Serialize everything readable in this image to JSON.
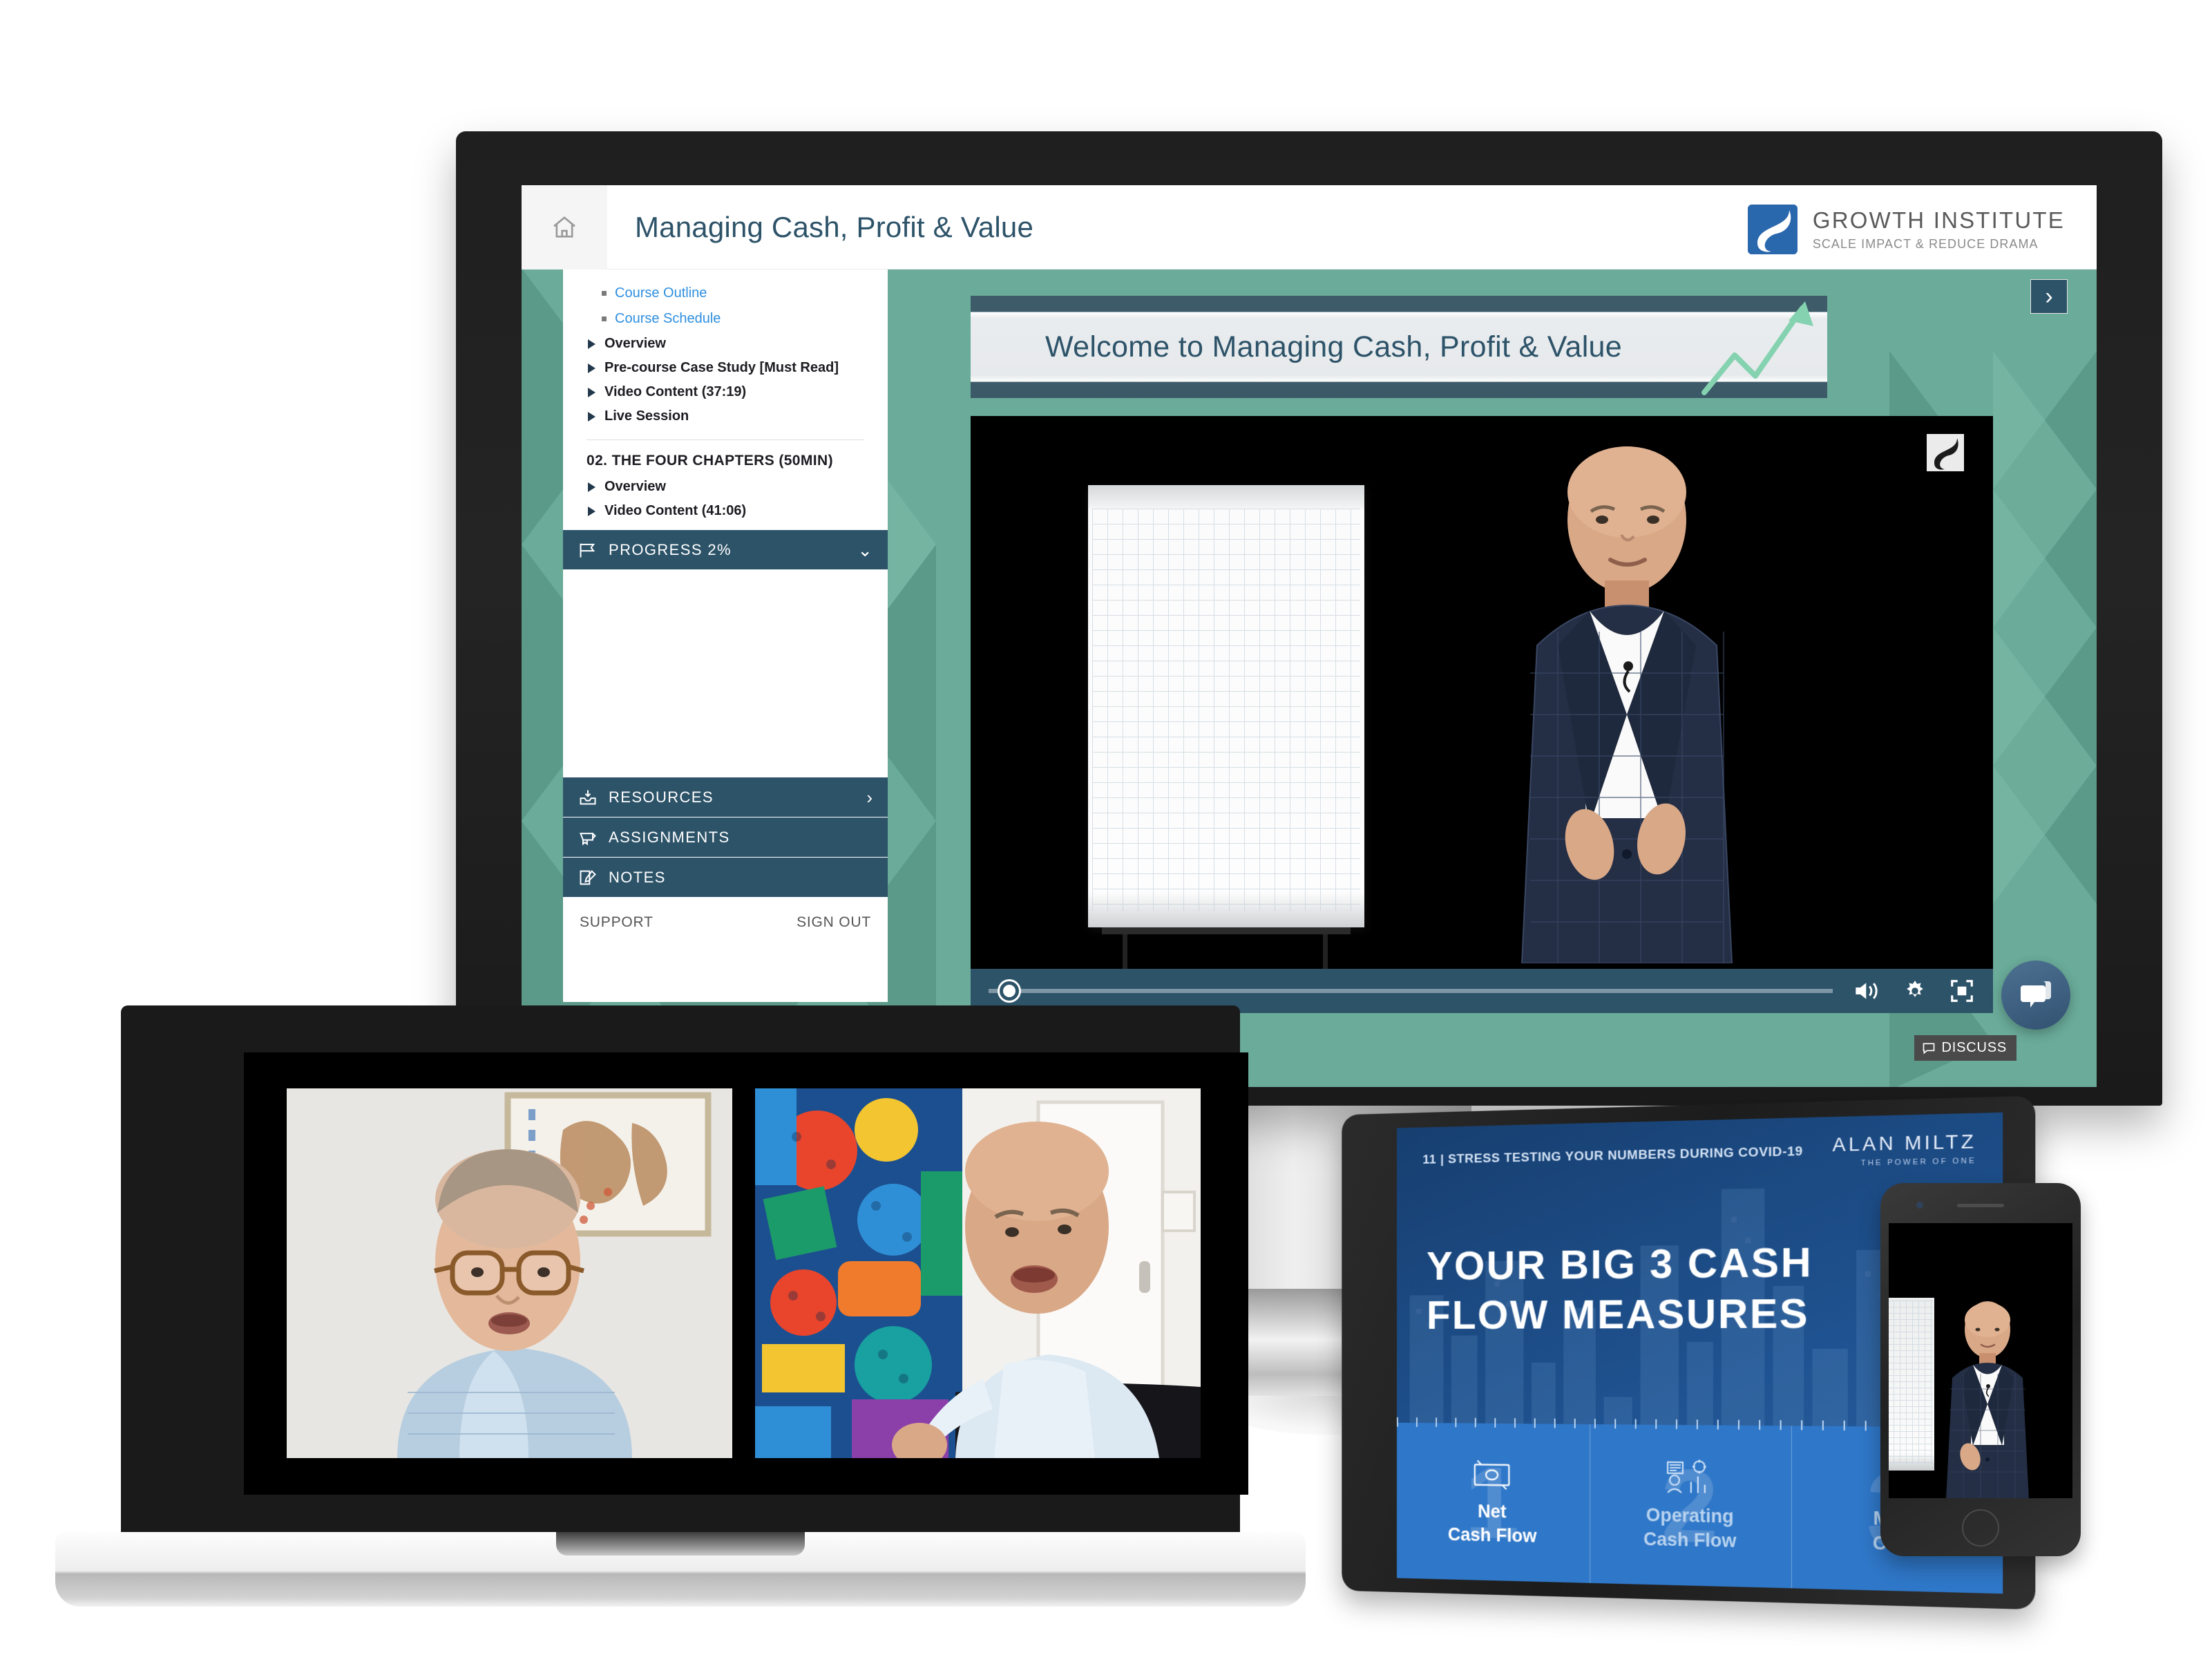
{
  "header": {
    "home_icon": "home-icon",
    "title": "Managing Cash, Profit & Value",
    "logo": {
      "name": "GROWTH  INSTITUTE",
      "tagline": "SCALE IMPACT & REDUCE DRAMA"
    }
  },
  "next_button": {
    "label": "›"
  },
  "sidebar": {
    "sub_links": [
      {
        "label": "Course Outline"
      },
      {
        "label": "Course Schedule"
      }
    ],
    "module_1_items": [
      {
        "label": "Overview"
      },
      {
        "label": "Pre-course Case Study [Must Read]"
      },
      {
        "label": "Video Content (37:19)"
      },
      {
        "label": "Live Session"
      }
    ],
    "section_2_title": "02. THE FOUR CHAPTERS (50MIN)",
    "module_2_items": [
      {
        "label": "Overview"
      },
      {
        "label": "Video Content (41:06)"
      }
    ],
    "progress": {
      "icon": "flag-icon",
      "label": "PROGRESS 2%",
      "chevron": "⌄"
    },
    "bars": [
      {
        "icon": "inbox-download-icon",
        "label": "RESOURCES",
        "chevron": "›"
      },
      {
        "icon": "diploma-icon",
        "label": "ASSIGNMENTS",
        "chevron": ""
      },
      {
        "icon": "note-edit-icon",
        "label": "NOTES",
        "chevron": ""
      }
    ],
    "footer": {
      "support": "SUPPORT",
      "sign_out": "SIGN OUT"
    }
  },
  "slide_banner": {
    "text": "Welcome to Managing Cash, Profit & Value"
  },
  "player": {
    "volume_icon": "volume-icon",
    "settings_icon": "gear-icon",
    "fullscreen_icon": "fullscreen-icon",
    "discuss_label": "DISCUSS",
    "discuss_icon": "speech-bubble-icon",
    "chat_icon": "chat-bubbles-icon"
  },
  "tablet_slide": {
    "eyebrow": "11 | STRESS TESTING YOUR NUMBERS DURING COVID-19",
    "brand": "ALAN  MILTZ",
    "brand_tagline": "THE POWER OF ONE",
    "title_line1": "YOUR BIG 3 CASH",
    "title_line2": "FLOW MEASURES",
    "measures": [
      {
        "number": "1",
        "line1": "Net",
        "line2": "Cash Flow",
        "icon": "banknote-icon"
      },
      {
        "number": "2",
        "line1": "Operating",
        "line2": "Cash Flow",
        "icon": "analytics-person-icon"
      },
      {
        "number": "3",
        "line1": "Marg",
        "line2": "Cash",
        "icon": "coin-stack-icon"
      }
    ]
  },
  "colors": {
    "accent_dark": "#2d5369",
    "brand_blue": "#2a68ae",
    "link_blue": "#2f8fe0",
    "wallpaper_green": "#6aab99",
    "slide_blue": "#2f77c8"
  }
}
